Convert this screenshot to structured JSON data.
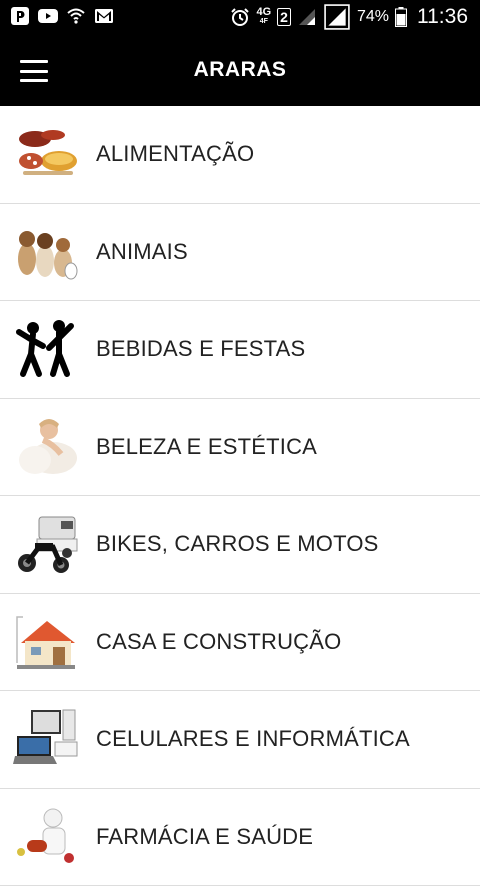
{
  "status_bar": {
    "network_type": "4G",
    "network_sub": "4F",
    "sim_slot": "2",
    "battery": "74%",
    "time": "11:36",
    "left_icons": [
      "p-app-icon",
      "youtube-icon",
      "wifi-icon",
      "gmail-icon"
    ]
  },
  "app_bar": {
    "title": "ARARAS"
  },
  "categories": [
    {
      "label": "ALIMENTAÇÃO",
      "icon": "food-icon"
    },
    {
      "label": "ANIMAIS",
      "icon": "animals-icon"
    },
    {
      "label": "BEBIDAS E FESTAS",
      "icon": "dancers-icon"
    },
    {
      "label": "BELEZA E ESTÉTICA",
      "icon": "beauty-icon"
    },
    {
      "label": "BIKES, CARROS E MOTOS",
      "icon": "vehicles-icon"
    },
    {
      "label": "CASA E CONSTRUÇÃO",
      "icon": "house-icon"
    },
    {
      "label": "CELULARES E INFORMÁTICA",
      "icon": "computer-icon"
    },
    {
      "label": "FARMÁCIA E SAÚDE",
      "icon": "pharmacy-icon"
    }
  ],
  "colors": {
    "app_bar": "#000000",
    "background": "#ffffff",
    "divider": "#dddddd",
    "text": "#222222"
  }
}
